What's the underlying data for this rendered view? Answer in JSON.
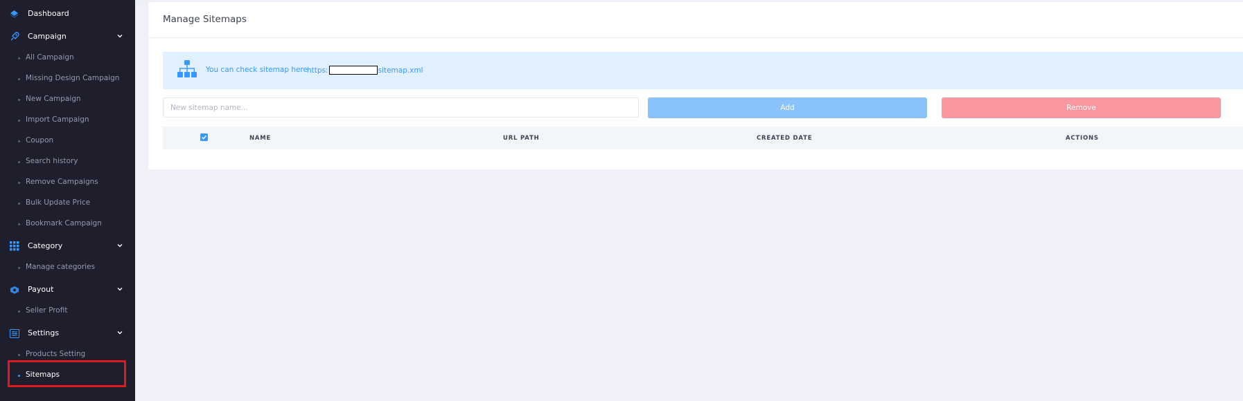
{
  "sidebar": {
    "dashboard": {
      "label": "Dashboard",
      "icon": "layers-icon"
    },
    "campaign": {
      "label": "Campaign",
      "icon": "rocket-icon",
      "items": [
        "All Campaign",
        "Missing Design Campaign",
        "New Campaign",
        "Import Campaign",
        "Coupon",
        "Search history",
        "Remove Campaigns",
        "Bulk Update Price",
        "Bookmark Campaign"
      ]
    },
    "category": {
      "label": "Category",
      "icon": "grid-icon",
      "items": [
        "Manage categories"
      ]
    },
    "payout": {
      "label": "Payout",
      "icon": "money-icon",
      "items": [
        "Seller Profit"
      ]
    },
    "settings": {
      "label": "Settings",
      "icon": "settings-sliders-icon",
      "items": [
        "Products Setting",
        "Sitemaps"
      ],
      "active_item": "Sitemaps"
    }
  },
  "main": {
    "title": "Manage Sitemaps",
    "banner": {
      "text": "You can check sitemap here",
      "link_prefix": "https:",
      "link_suffix": "sitemap.xml",
      "icon": "sitemap-icon"
    },
    "form": {
      "input_placeholder": "New sitemap name...",
      "add_label": "Add",
      "remove_label": "Remove"
    },
    "table": {
      "select_all_checked": true,
      "columns": [
        "NAME",
        "URL PATH",
        "CREATED DATE",
        "ACTIONS"
      ]
    }
  },
  "colors": {
    "sidebar_bg": "#1e1e2d",
    "accent": "#3699ff",
    "add_button": "#8ac3fb",
    "remove_button": "#f8979f",
    "banner_bg": "#e1f0ff",
    "highlight": "#e0191e"
  }
}
